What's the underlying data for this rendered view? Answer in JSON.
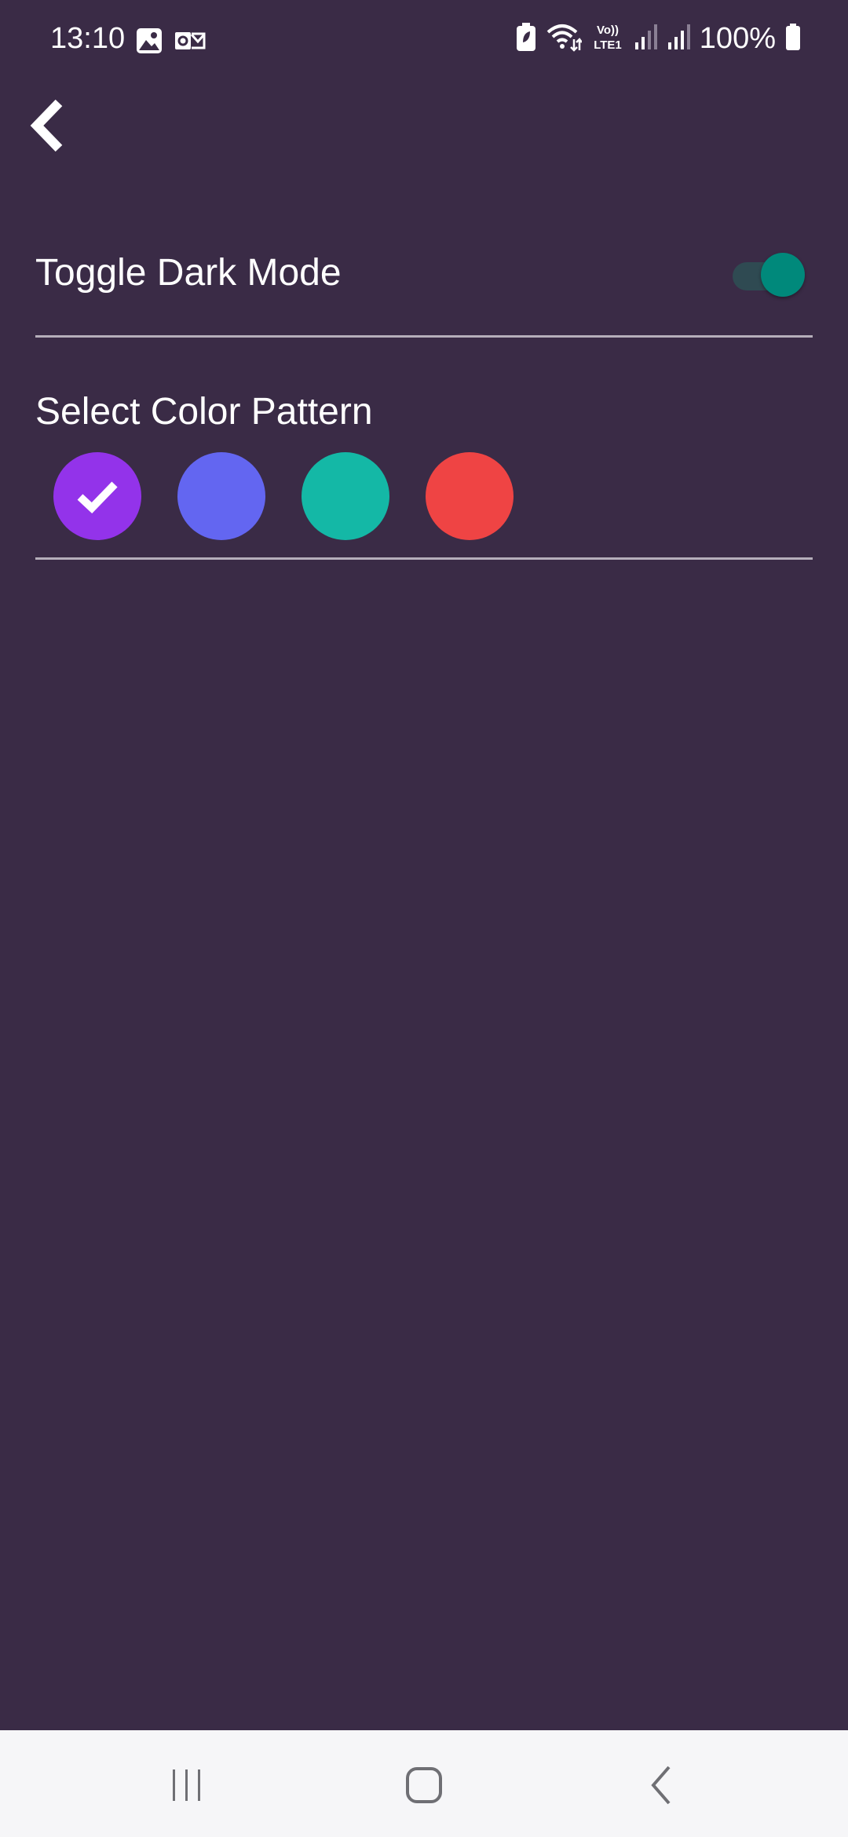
{
  "status_bar": {
    "time": "13:10",
    "battery": "100%",
    "left_icons": [
      "gallery-icon",
      "outlook-icon"
    ],
    "right_icons": [
      "battery-saver-icon",
      "wifi-icon",
      "volte-icon",
      "signal-icon",
      "signal-icon",
      "battery-icon"
    ]
  },
  "settings": {
    "dark_mode_label": "Toggle Dark Mode",
    "dark_mode_on": true,
    "color_pattern_label": "Select Color Pattern",
    "selected_color_index": 0,
    "colors": [
      "#9333ea",
      "#6366f1",
      "#14b8a6",
      "#ef4444"
    ]
  },
  "colors": {
    "background": "#3a2b46",
    "divider": "#b5aeba",
    "toggle_thumb": "#00897b",
    "toggle_track": "#2f4a52",
    "nav_bar": "#f6f6f8"
  },
  "nav": [
    "recent-apps-icon",
    "home-icon",
    "back-icon"
  ]
}
